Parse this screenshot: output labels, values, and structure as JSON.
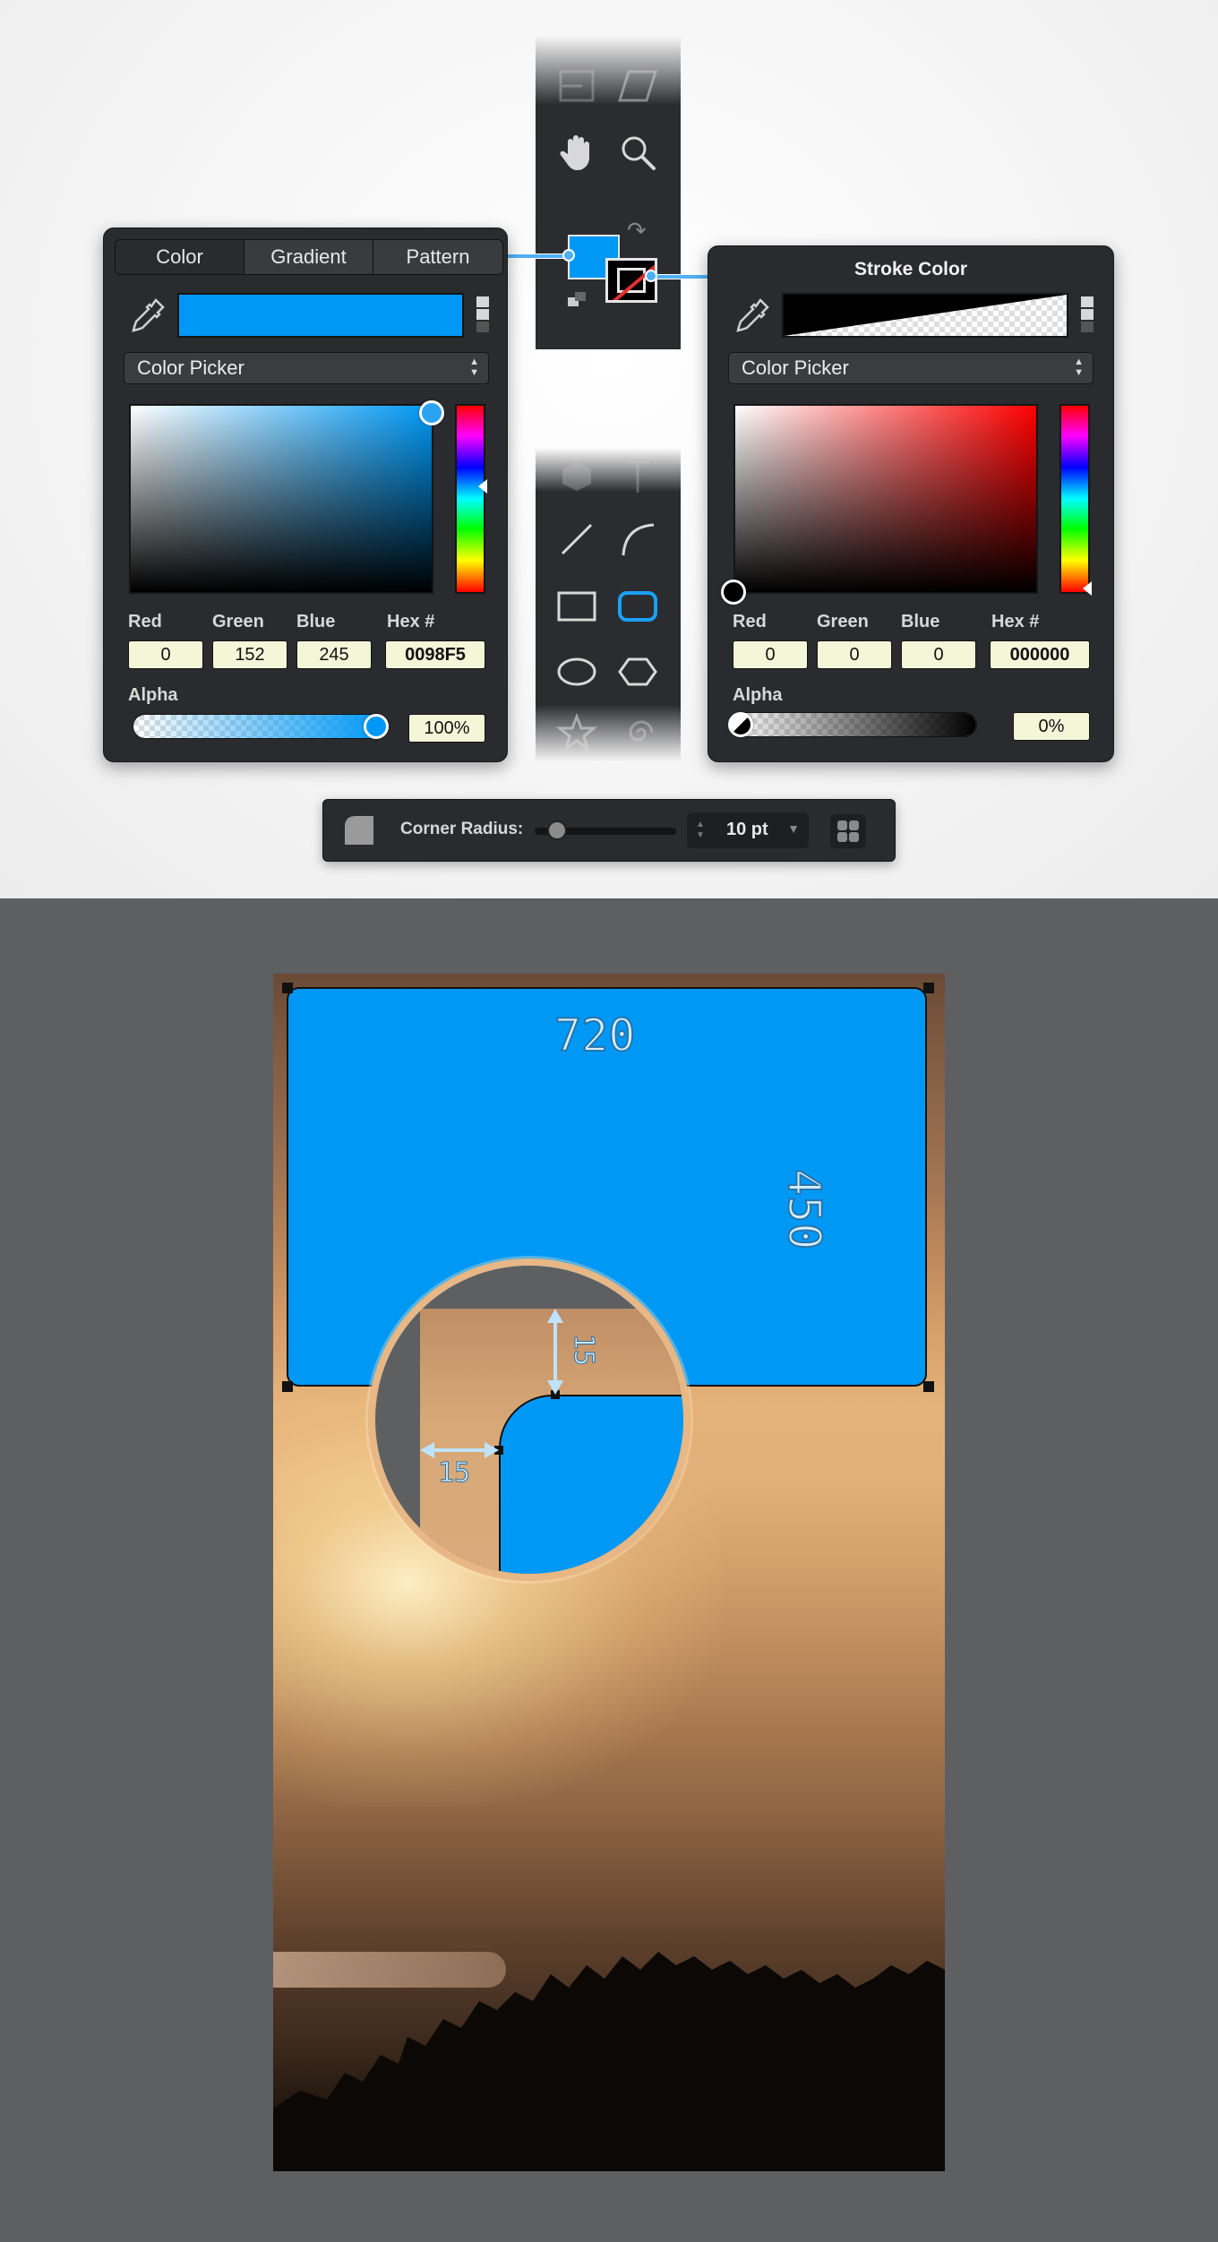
{
  "toolbar": {
    "tools": [
      {
        "name": "artboard-icon"
      },
      {
        "name": "skew-icon"
      },
      {
        "name": "hand-icon"
      },
      {
        "name": "zoom-icon"
      },
      {
        "name": "3d-box-icon"
      },
      {
        "name": "text-icon"
      },
      {
        "name": "line-icon"
      },
      {
        "name": "arc-icon"
      },
      {
        "name": "rectangle-icon"
      },
      {
        "name": "rounded-rectangle-icon"
      },
      {
        "name": "ellipse-icon"
      },
      {
        "name": "polygon-icon"
      },
      {
        "name": "star-icon"
      },
      {
        "name": "spiral-icon"
      }
    ],
    "fill_swatch_color": "#0098F5",
    "stroke_swatch_color": "#000000"
  },
  "fill_panel": {
    "tabs": [
      "Color",
      "Gradient",
      "Pattern"
    ],
    "active_tab": "Color",
    "mode": "Color Picker",
    "labels": {
      "red": "Red",
      "green": "Green",
      "blue": "Blue",
      "hex": "Hex #",
      "alpha": "Alpha"
    },
    "red": "0",
    "green": "152",
    "blue": "245",
    "hex": "0098F5",
    "alpha": "100%",
    "color": "#0098F5"
  },
  "stroke_panel": {
    "title": "Stroke Color",
    "mode": "Color Picker",
    "labels": {
      "red": "Red",
      "green": "Green",
      "blue": "Blue",
      "hex": "Hex #",
      "alpha": "Alpha"
    },
    "red": "0",
    "green": "0",
    "blue": "0",
    "hex": "000000",
    "alpha": "0%",
    "color": "#000000"
  },
  "corner_radius_bar": {
    "label": "Corner Radius:",
    "value": "10 pt",
    "slider_fraction": 0.1
  },
  "canvas": {
    "rect_width_label": "720",
    "rect_height_label": "450",
    "corner_vertical_label": "15",
    "corner_horizontal_label": "15",
    "rect_color": "#0098F5"
  }
}
